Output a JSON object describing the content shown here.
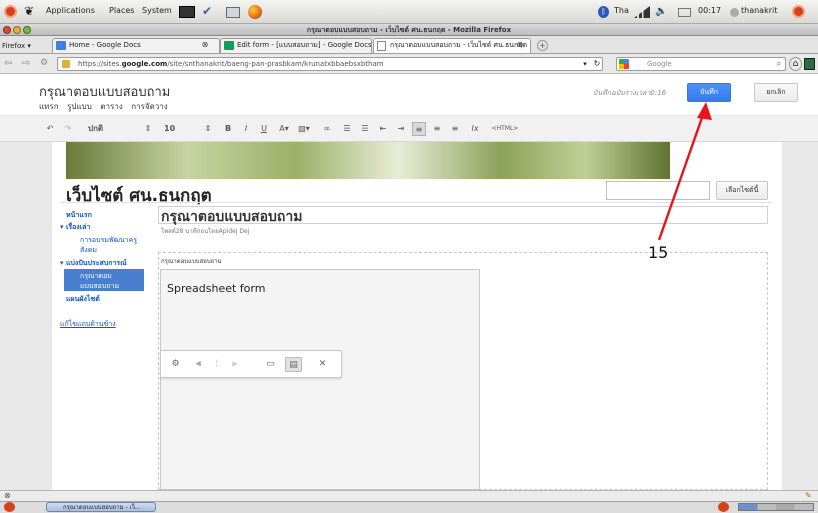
{
  "gnome_panel": {
    "menus": [
      "Applications",
      "Places",
      "System"
    ],
    "keyboard_layout": "Tha",
    "clock": "00:17",
    "user": "thanakrit"
  },
  "window": {
    "title": "กรุณาตอบแบบสอบถาม - เว็บไซต์ ศน.ธนกฤต - Mozilla Firefox",
    "menu_button": "Firefox"
  },
  "tabs": [
    {
      "label": "Home - Google Docs"
    },
    {
      "label": "Edit form - [แบบสอบถาม] - Google Docs"
    },
    {
      "label": "กรุณาตอบแบบสอบถาม - เว็บไซต์ ศน.ธนกฤต"
    }
  ],
  "nav": {
    "url_prefix": "https://sites.",
    "url_domain": "google.com",
    "url_rest": "/site/snthanakrit/baeng-pan-prasbkam/krunatxbbaebsxbtham",
    "search_placeholder": "Google"
  },
  "sites_header": {
    "page_title": "กรุณาตอบแบบสอบถาม",
    "menu": [
      "แทรก",
      "รูปแบบ",
      "ตาราง",
      "การจัดวาง"
    ],
    "autosave_text": "บันทึกฉบับร่างเวลา0:16",
    "save_label": "บันทึก",
    "cancel_label": "ยกเลิก"
  },
  "toolbar": {
    "font": "ปกติ",
    "size": "10",
    "html_label": "<HTML>"
  },
  "site": {
    "name": "เว็บไซต์ ศน.ธนกฤต",
    "search_button": "เลือกไซต์นี้"
  },
  "sidebar": {
    "items": [
      {
        "label": "หน้าแรก",
        "level": 0
      },
      {
        "label": "▾ เรื่องเล่า",
        "level": 0
      },
      {
        "label": "การอบรมพัฒนาครู",
        "level": 1
      },
      {
        "label": "สังคม",
        "level": 1
      },
      {
        "label": "▾ แบ่งปันประสบการณ์",
        "level": 0
      },
      {
        "label": "กรุณาตอบ",
        "level": 1
      },
      {
        "label": "แบบสอบถาม",
        "level": 1
      },
      {
        "label": "แผนผังไซต์",
        "level": 0
      }
    ],
    "edit_link": "แก้ไขแถบด้านข้าง"
  },
  "content": {
    "heading": "กรุณาตอบแบบสอบถาม",
    "meta": "โพสต์28 นาทีก่อนโดยApidej Dej",
    "body_label": "กรุณาตอบแบบสอบถาม",
    "gadget_title": "Spreadsheet form"
  },
  "annotation": {
    "number": "15",
    "color": "#e8141b"
  },
  "taskbar": {
    "window_label": "กรุณาตอบแบบสอบถาม - เว็..."
  }
}
